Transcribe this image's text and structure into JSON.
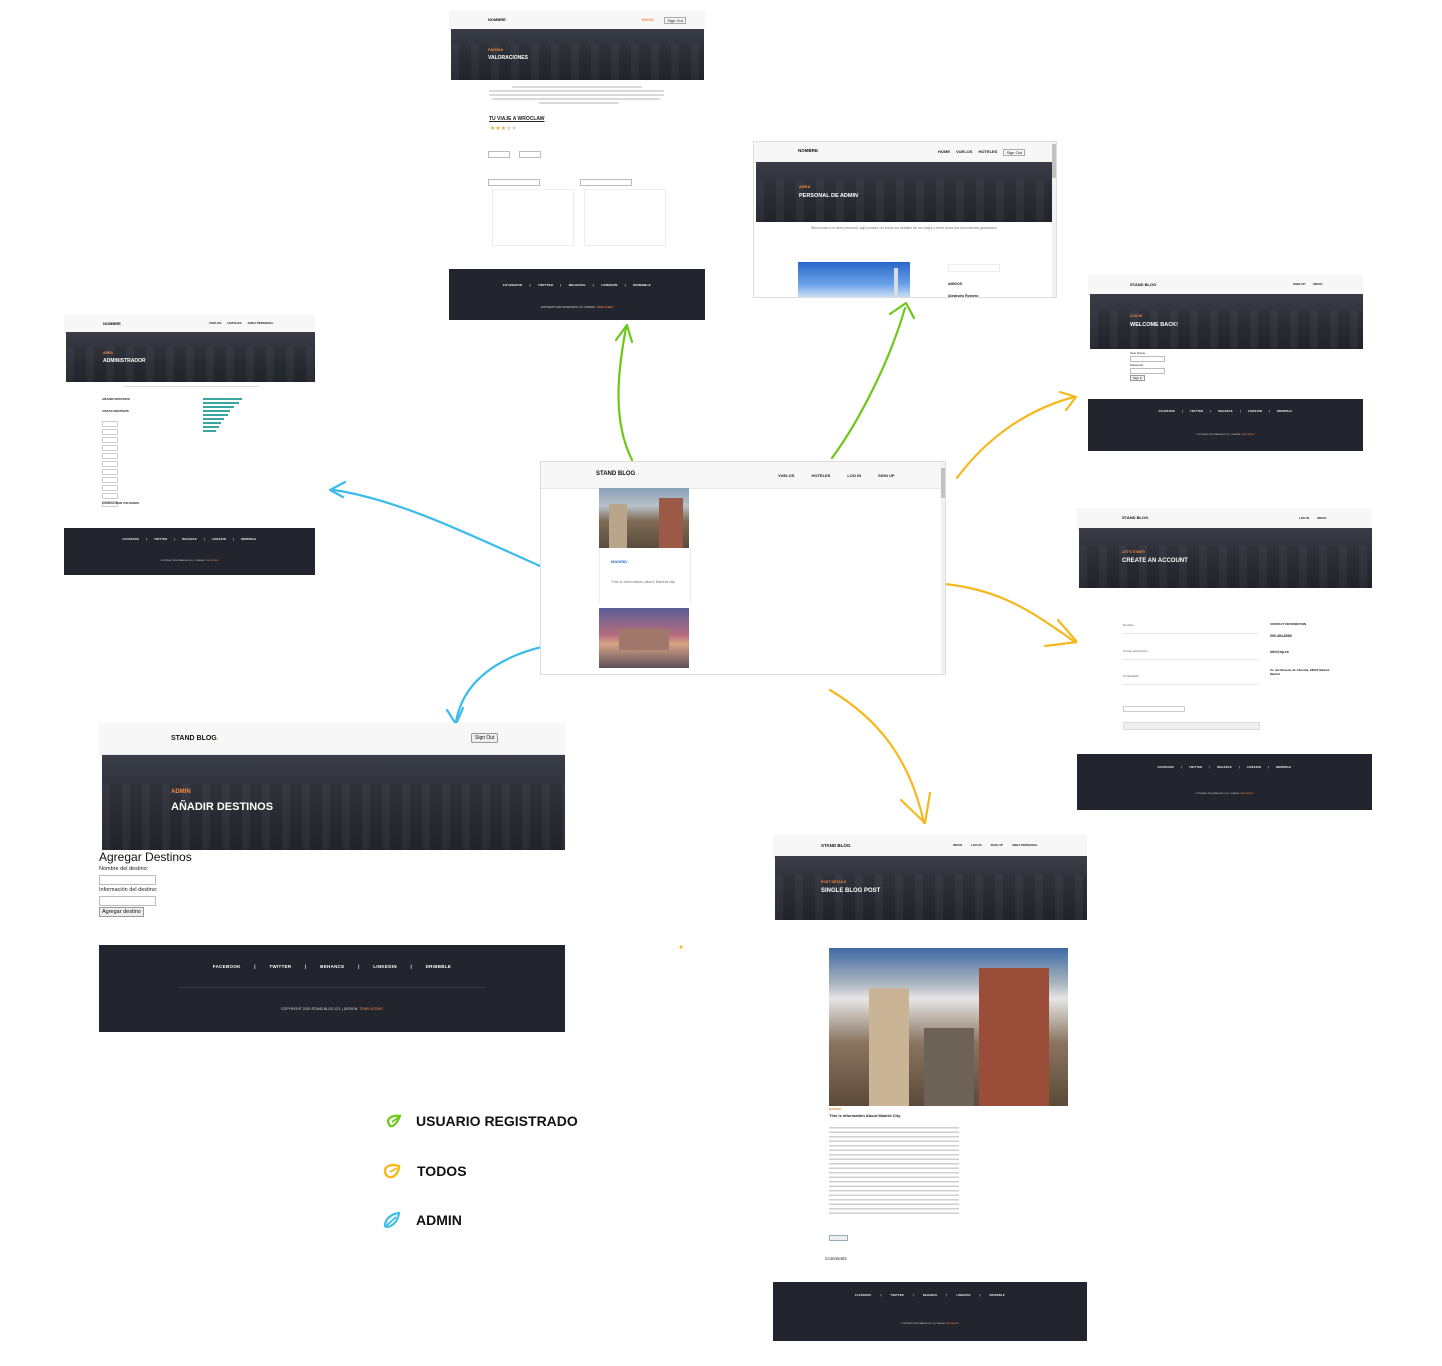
{
  "colors": {
    "accent": "#f48840",
    "hero_dark": "#2b2e36",
    "footer_dark": "#22252e",
    "arrow_green": "#6cc817",
    "arrow_yellow": "#f5b91e",
    "arrow_blue": "#3bbcea"
  },
  "central": {
    "logo": "STAND BLOG",
    "menu": [
      "VUELOS",
      "HOTELES",
      "LOG IN",
      "SIGN UP"
    ],
    "card1_tag": "MADRID",
    "card1_text": "This is information about Madrid city"
  },
  "valoraciones": {
    "logo": "NOMBRE",
    "menu": [
      "INICIO",
      "Sign Out"
    ],
    "kicker": "PAGINA",
    "title": "VALORACIONES",
    "trip_title": "TU VIAJE A WROCLAW"
  },
  "personal": {
    "logo": "NOMBRE",
    "menu": [
      "HOME",
      "VUELOS",
      "HOTELES",
      "Sign Out"
    ],
    "kicker": "AREA",
    "title": "PERSONAL DE ADMIN",
    "welcome": "Bienvenido a tu área personal, aquí podrás ver todos los detalles de tus viajes y tener todos tus documentos guardados",
    "side_title": "AMIGOS",
    "side_name": "Alejandro Romero"
  },
  "administrador": {
    "logo": "NOMBRE",
    "menu": [
      "VUELOS",
      "HOTELES",
      "AREA PERSONAL"
    ],
    "kicker": "AREA",
    "title": "ADMINISTRADOR",
    "sections": [
      "AÑADIR DESTINOS",
      "VISTAS DESTINOS",
      "CONFIGURAR USUARIOS"
    ]
  },
  "welcome_back": {
    "logo": "STAND BLOG",
    "menu": [
      "SIGN UP",
      "INICIO"
    ],
    "kicker": "LOG IN",
    "title": "WELCOME BACK!",
    "field1": "User Name",
    "field2": "Password",
    "button": "Sign in"
  },
  "create_account": {
    "logo": "STAND BLOG",
    "menu": [
      "LOG IN",
      "INICIO"
    ],
    "kicker": "LET'S START!",
    "title": "CREATE AN ACCOUNT",
    "fields": [
      "Nombre",
      "Correo electrónico",
      "Contraseña"
    ],
    "contact_title": "CONTACT INFORMATION",
    "phone": "090-484-8080",
    "email": "info@sp.es",
    "address": "Av. del Ricardo de Almeida, 28003 Madrid, Madrid"
  },
  "anadir": {
    "logo": "STAND BLOG",
    "signout": "Sign Out",
    "kicker": "ADMIN",
    "title": "AÑADIR DESTINOS",
    "form_title": "Agregar Destinos",
    "label1": "Nombre del destino:",
    "label2": "Información del destino:",
    "button": "Agregar destino"
  },
  "single_post": {
    "logo": "STAND BLOG",
    "menu": [
      "INICIO",
      "LOG IN",
      "SIGN UP",
      "AREA PERSONAL"
    ],
    "kicker": "POST DETAILS",
    "title": "SINGLE BLOG POST",
    "tag": "MADRID",
    "post_title": "This is information About Madrid City.",
    "comments": "Comments"
  },
  "footer": {
    "links": [
      "FACEBOOK",
      "|",
      "TWITTER",
      "|",
      "BEHANCE",
      "|",
      "LINKEDIN",
      "|",
      "DRIBBBLE"
    ],
    "copyright": "COPYRIGHT 2020 STAND BLOG CO. | DESIGN: ",
    "copyright_accent": "TEMPLATEMO"
  },
  "legend": [
    {
      "label": "USUARIO REGISTRADO",
      "color": "#6cc817"
    },
    {
      "label": "TODOS",
      "color": "#f5b91e"
    },
    {
      "label": "ADMIN",
      "color": "#3bbcea"
    }
  ]
}
